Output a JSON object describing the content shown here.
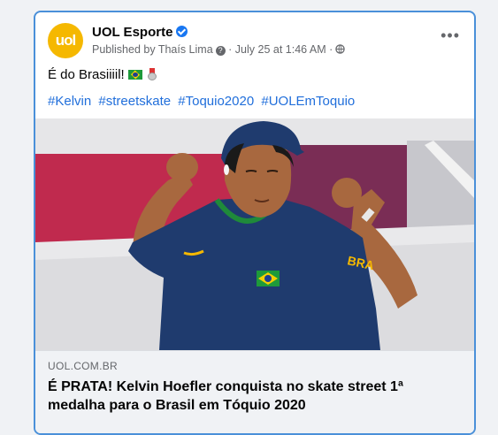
{
  "post": {
    "avatar_text": "uol",
    "page_name": "UOL Esporte",
    "published_by": "Published by Thaís Lima",
    "date": "July 25 at 1:46 AM",
    "separator": "·",
    "more_label": "•••",
    "body_text": "É do Brasiiiil!",
    "hashtags": [
      "#Kelvin",
      "#streetskate",
      "#Toquio2020",
      "#UOLEmToquio"
    ],
    "photo_text": "BRA",
    "link": {
      "domain": "UOL.COM.BR",
      "title": "É PRATA! Kelvin Hoefler conquista no skate street 1ª medalha para o Brasil em Tóquio 2020"
    }
  },
  "colors": {
    "brand": "#f5b800",
    "link": "#216fdb",
    "selection_border": "#4a90d9",
    "jersey": "#1f3b6e",
    "jersey_trim": "#1f8a3a"
  },
  "icons": [
    "verified-badge-icon",
    "question-icon",
    "globe-icon",
    "more-options-icon",
    "brazil-flag-emoji",
    "medal-emoji"
  ]
}
